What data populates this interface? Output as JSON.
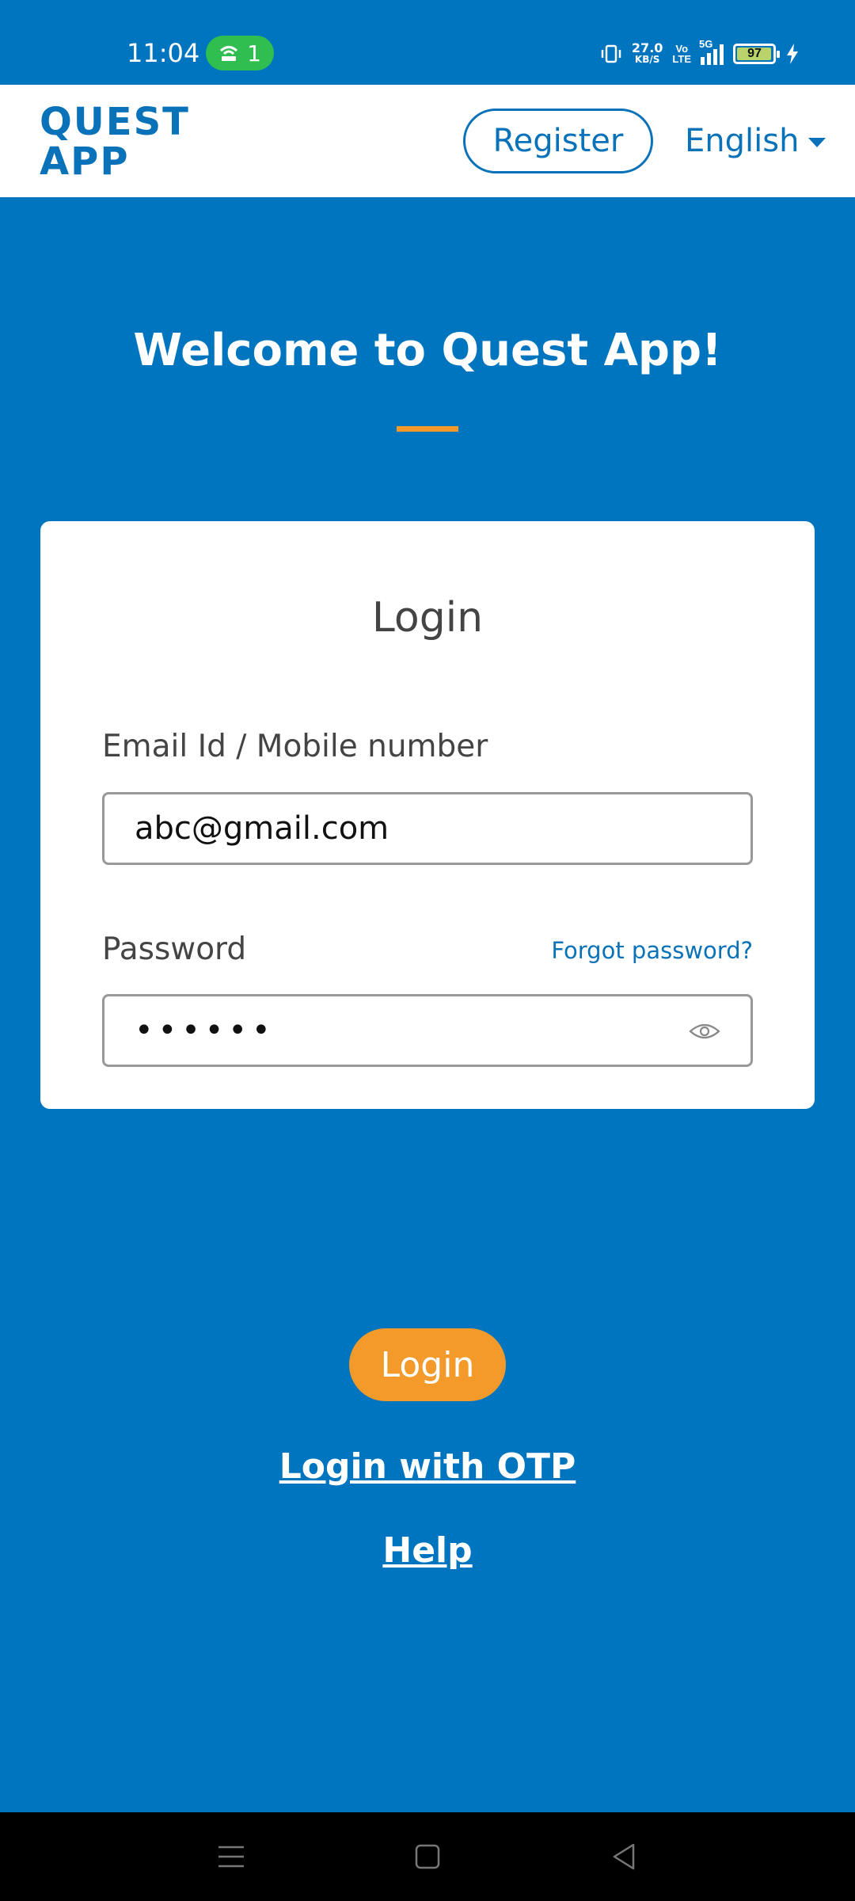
{
  "status_bar": {
    "time": "11:04",
    "hotspot_count": "1",
    "net_speed": "27.0",
    "net_unit": "KB/S",
    "volte_top": "Vo",
    "volte_bottom": "LTE",
    "network": "5G",
    "battery": "97"
  },
  "header": {
    "logo_line1": "QUEST",
    "logo_line2": "APP",
    "register_label": "Register",
    "language": "English"
  },
  "welcome": {
    "title": "Welcome to Quest App!"
  },
  "login_form": {
    "title": "Login",
    "email_label": "Email Id / Mobile number",
    "email_value": "abc@gmail.com",
    "password_label": "Password",
    "forgot_label": "Forgot password?",
    "password_value": "••••••"
  },
  "actions": {
    "login_label": "Login",
    "otp_label": "Login with OTP",
    "help_label": "Help"
  },
  "colors": {
    "primary": "#0075bf",
    "accent": "#f39a2b",
    "card": "#ffffff"
  }
}
